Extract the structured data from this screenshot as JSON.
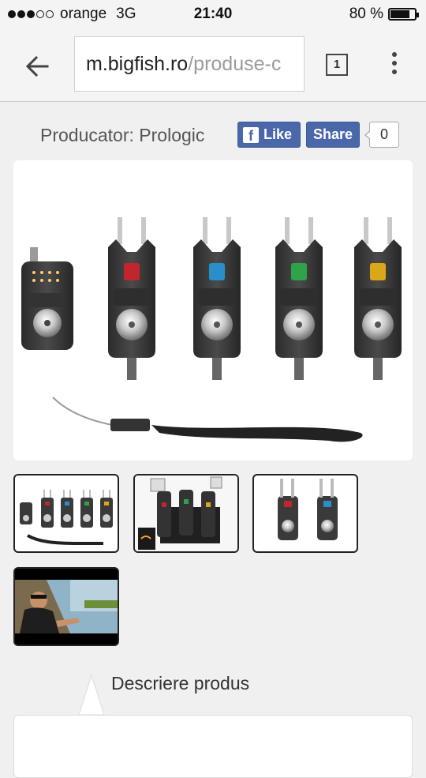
{
  "status_bar": {
    "carrier": "orange",
    "network": "3G",
    "time": "21:40",
    "battery": "80 %",
    "battery_level": 0.8,
    "signal_bars_filled": 3,
    "signal_bars_total": 5
  },
  "browser": {
    "url_host": "m.bigfish.ro",
    "url_path": "/produse-c",
    "tab_count": "1",
    "back_icon": "arrow-left-icon",
    "menu_icon": "more-vert-icon"
  },
  "product": {
    "producer": "Producator: Prologic",
    "facebook": {
      "like_label": "Like",
      "share_label": "Share",
      "share_count": "0",
      "brand_color": "#4a67a9"
    },
    "led_colors": [
      "#c0262b",
      "#2a8fc8",
      "#2fa24a",
      "#d8a81a"
    ],
    "description_title": "Descriere produs"
  }
}
